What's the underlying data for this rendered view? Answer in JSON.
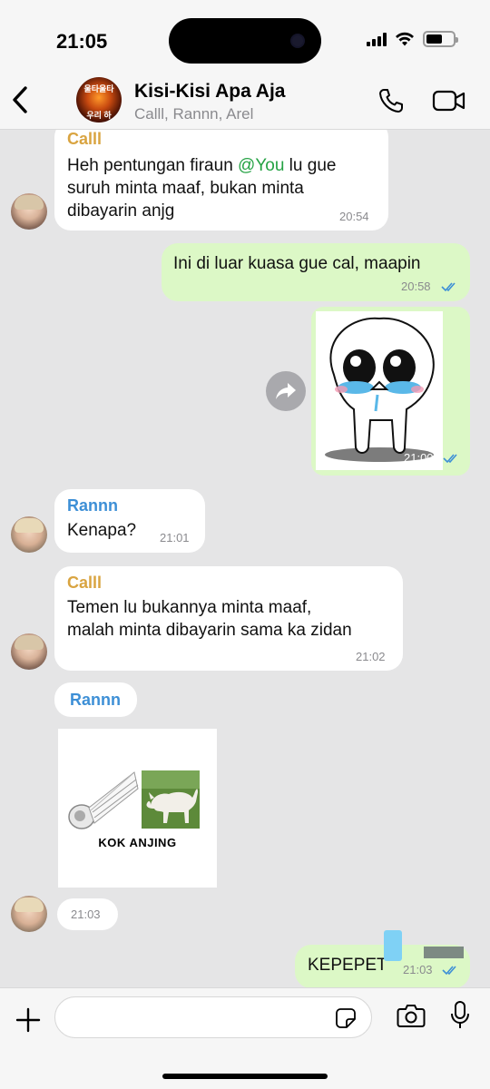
{
  "status_bar": {
    "time": "21:05"
  },
  "header": {
    "title": "Kisi-Kisi Apa Aja",
    "participants": "Calll, Rannn, Arel",
    "avatar_text_top": "울타울타",
    "avatar_text_bottom": "우리 하"
  },
  "messages": [
    {
      "sender": "Calll",
      "text_before_mention": "Heh pentungan firaun ",
      "mention": "@You",
      "text_line1_after": " lu gue",
      "text_line2": "suruh minta maaf, bukan minta",
      "text_line3": "dibayarin anjg",
      "time": "20:54"
    },
    {
      "text": "Ini di luar kuasa gue cal, maapin",
      "time": "20:58"
    },
    {
      "sticker": "crying-sticker",
      "time": "21:00"
    },
    {
      "sender": "Rannn",
      "text": "Kenapa?",
      "time": "21:01"
    },
    {
      "sender": "Calll",
      "line1": "Temen lu bukannya minta maaf,",
      "line2": "malah minta dibayarin sama ka zidan",
      "time": "21:02"
    },
    {
      "sender": "Rannn",
      "image_caption": "KOK ANJING",
      "time": "21:03"
    },
    {
      "text": "KEPEPET",
      "time": "21:03"
    }
  ],
  "colors": {
    "calll": "#d9a441",
    "rannn": "#3d8fd6",
    "mention": "#25a244",
    "outgoing": "#dcf8c6",
    "read_ticks": "#3d8fd6"
  }
}
